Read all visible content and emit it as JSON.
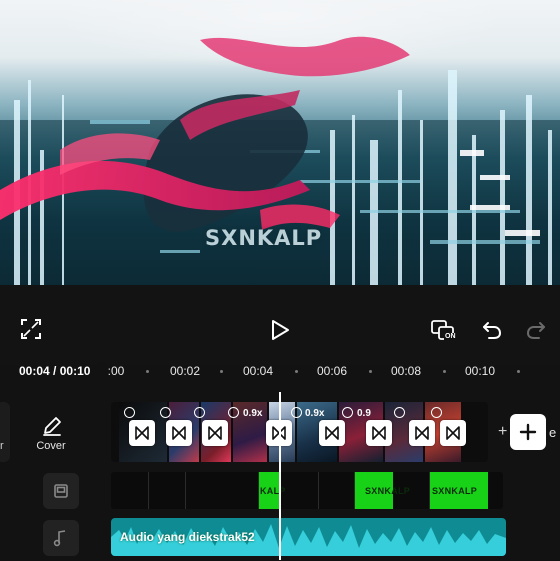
{
  "preview": {
    "watermark": "SXNKALP"
  },
  "toolbar": {
    "fullscreen_icon": "fullscreen-icon",
    "play_icon": "play-icon",
    "keyframe_icon": "keyframe-on-icon",
    "keyframe_badge": "ON",
    "undo_icon": "undo-icon",
    "redo_icon": "redo-icon"
  },
  "timeline": {
    "current_time": "00:04",
    "total_time": "00:10",
    "time_separator": " / ",
    "ruler_ticks": [
      ":00",
      "00:02",
      "00:04",
      "00:06",
      "00:08",
      "00:10"
    ]
  },
  "left_panel": {
    "edge_text": "r",
    "cover_label": "Cover"
  },
  "clips": {
    "speeds": [
      "0.9x",
      "0.9x",
      "0.9"
    ]
  },
  "add": {
    "plus_text": "+",
    "ending_text": "e"
  },
  "overlay": {
    "labels": [
      "KALP",
      "SXNKALP",
      "SXNKALP"
    ]
  },
  "audio": {
    "label": "Audio yang diekstrak52"
  },
  "colors": {
    "background": "#121212",
    "overlay_green": "#17d217",
    "audio_teal": "#0f8c93",
    "audio_wave": "#3cd9e6"
  }
}
